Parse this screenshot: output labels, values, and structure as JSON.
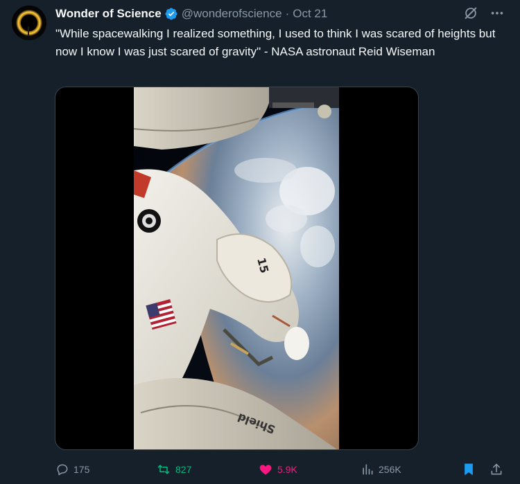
{
  "author": {
    "display_name": "Wonder of Science",
    "handle": "@wonderofscience",
    "separator": "·",
    "date": "Oct 21"
  },
  "tweet": {
    "text": "\"While spacewalking I realized something, I used to think I was scared of heights but now I know I was just scared of gravity\" - NASA astronaut Reid Wiseman"
  },
  "media": {
    "module_label": "Shield",
    "suit_number": "15"
  },
  "actions": {
    "replies": "175",
    "retweets": "827",
    "likes": "5.9K",
    "views": "256K"
  },
  "icons": {
    "verified": "verified-badge-icon",
    "grok": "grok-icon",
    "more": "more-icon",
    "reply": "reply-icon",
    "retweet": "retweet-icon",
    "like": "heart-icon",
    "views": "views-icon",
    "bookmark": "bookmark-icon",
    "share": "share-icon"
  },
  "colors": {
    "background": "#15202b",
    "secondary_text": "#8b98a5",
    "verified": "#1d9bf0",
    "retweet_active": "#00ba7c",
    "like_active": "#f91880",
    "bookmark_active": "#1d9bf0"
  }
}
